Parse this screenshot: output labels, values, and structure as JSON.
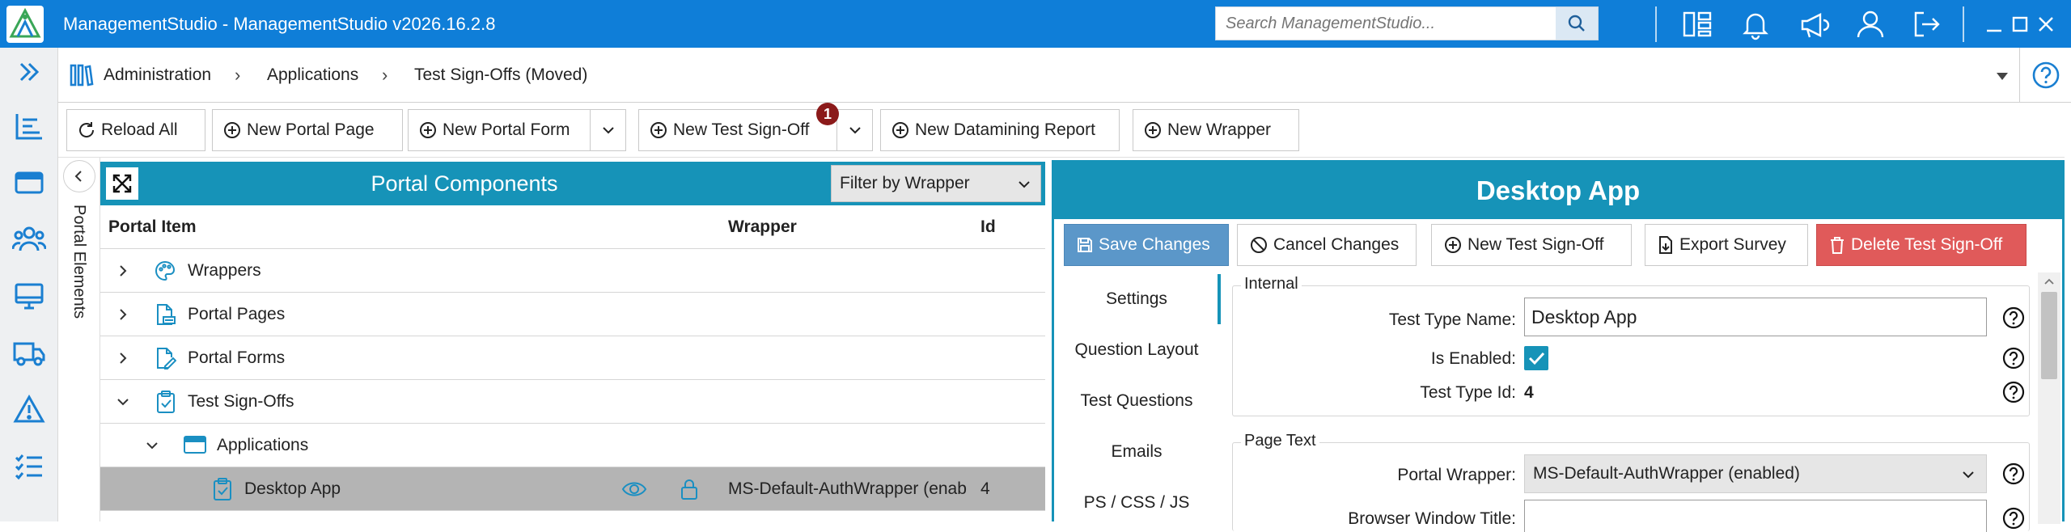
{
  "titlebar": {
    "app_title": "ManagementStudio - ManagementStudio v2026.16.2.8",
    "search_placeholder": "Search ManagementStudio..."
  },
  "breadcrumb": {
    "items": [
      "Administration",
      "Applications",
      "Test Sign-Offs (Moved)"
    ]
  },
  "toolbar": {
    "reload_all": "Reload All",
    "new_portal_page": "New Portal Page",
    "new_portal_form": "New Portal Form",
    "new_test_signoff": "New Test Sign-Off",
    "new_test_signoff_badge": "1",
    "new_datamining_report": "New Datamining Report",
    "new_wrapper": "New Wrapper"
  },
  "sidetab": {
    "label": "Portal Elements"
  },
  "left_panel": {
    "title": "Portal Components",
    "filter": "Filter by Wrapper",
    "columns": [
      "Portal Item",
      "Wrapper",
      "Id"
    ],
    "rows": [
      {
        "label": "Wrappers",
        "icon": "palette-icon",
        "expanded": false
      },
      {
        "label": "Portal Pages",
        "icon": "doc-page-icon",
        "expanded": false
      },
      {
        "label": "Portal Forms",
        "icon": "form-edit-icon",
        "expanded": false
      },
      {
        "label": "Test Sign-Offs",
        "icon": "clipboard-check-icon",
        "expanded": true
      },
      {
        "label": "Applications",
        "icon": "app-window-icon",
        "expanded": true
      },
      {
        "label": "Desktop App",
        "icon": "clipboard-check-icon",
        "wrapper": "MS-Default-AuthWrapper (enab",
        "id": "4",
        "selected": true
      }
    ]
  },
  "right_panel": {
    "title": "Desktop App",
    "actions": {
      "save": "Save Changes",
      "cancel": "Cancel Changes",
      "new_test_signoff": "New Test Sign-Off",
      "export_survey": "Export Survey",
      "delete": "Delete Test Sign-Off"
    },
    "tabs": [
      "Settings",
      "Question Layout",
      "Test Questions",
      "Emails",
      "PS / CSS / JS"
    ],
    "internal": {
      "group_label": "Internal",
      "test_type_name_label": "Test Type Name:",
      "test_type_name_value": "Desktop App",
      "is_enabled_label": "Is Enabled:",
      "is_enabled": true,
      "test_type_id_label": "Test Type Id:",
      "test_type_id_value": "4"
    },
    "page_text": {
      "group_label": "Page Text",
      "portal_wrapper_label": "Portal Wrapper:",
      "portal_wrapper_value": "MS-Default-AuthWrapper (enabled)",
      "browser_window_title_label": "Browser Window Title:"
    }
  },
  "colors": {
    "titlebar": "#0f7ed8",
    "panel_header": "#1693b8",
    "save_button": "#5b97c9",
    "delete_button": "#e05a5a",
    "badge": "#8b1a1a",
    "selected_row": "#b4b4b4"
  }
}
